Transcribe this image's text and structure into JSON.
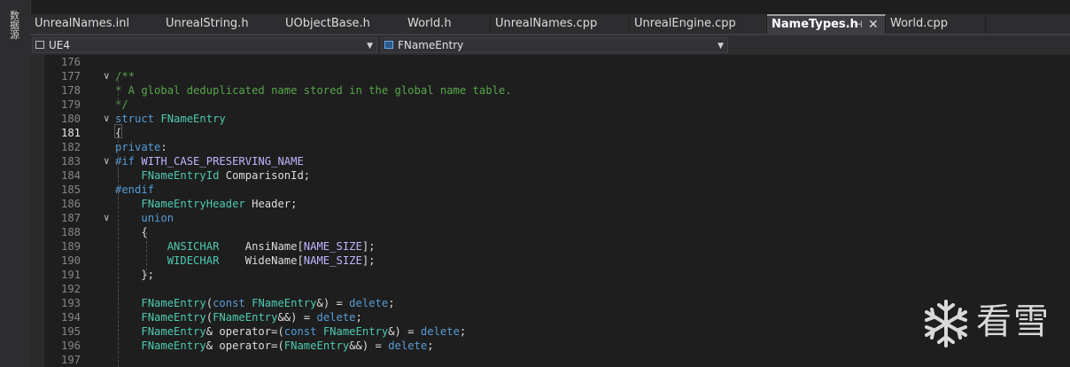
{
  "side_panel": {
    "label": "数据源"
  },
  "tabs": [
    {
      "label": "UnrealNames.inl",
      "active": false
    },
    {
      "label": "UnrealString.h",
      "active": false
    },
    {
      "label": "UObjectBase.h",
      "active": false
    },
    {
      "label": "World.h",
      "active": false
    },
    {
      "label": "UnrealNames.cpp",
      "active": false
    },
    {
      "label": "UnrealEngine.cpp",
      "active": false
    },
    {
      "label": "NameTypes.h",
      "active": true
    },
    {
      "label": "World.cpp",
      "active": false
    }
  ],
  "tab_icons": {
    "pin": "pin-icon",
    "close": "close-icon"
  },
  "navbar": {
    "project": "UE4",
    "scope": "FNameEntry"
  },
  "editor": {
    "current_line": 181,
    "lines": [
      {
        "n": "176",
        "fold": "",
        "html": ""
      },
      {
        "n": "177",
        "fold": "v",
        "html": "<span class=\"c\">/**</span>"
      },
      {
        "n": "178",
        "fold": "",
        "html": "<span class=\"c\">* A global deduplicated name stored in the global name table.</span>"
      },
      {
        "n": "179",
        "fold": "",
        "html": "<span class=\"c\">*/</span>"
      },
      {
        "n": "180",
        "fold": "v",
        "html": "<span class=\"k\">struct</span> <span class=\"t\">FNameEntry</span>"
      },
      {
        "n": "181",
        "fold": "",
        "html": "{"
      },
      {
        "n": "182",
        "fold": "",
        "html": "<span class=\"k\">private</span>:"
      },
      {
        "n": "183",
        "fold": "v",
        "html": "<span class=\"k\">#if</span> <span class=\"m\">WITH_CASE_PRESERVING_NAME</span>"
      },
      {
        "n": "184",
        "fold": "",
        "html": "    <span class=\"t\">FNameEntryId</span> ComparisonId;"
      },
      {
        "n": "185",
        "fold": "",
        "html": "<span class=\"k\">#endif</span>"
      },
      {
        "n": "186",
        "fold": "",
        "html": "    <span class=\"t\">FNameEntryHeader</span> Header;"
      },
      {
        "n": "187",
        "fold": "v",
        "html": "    <span class=\"k\">union</span>"
      },
      {
        "n": "188",
        "fold": "",
        "html": "    {"
      },
      {
        "n": "189",
        "fold": "",
        "html": "        <span class=\"t\">ANSICHAR</span>    AnsiName[<span class=\"m\">NAME_SIZE</span>];"
      },
      {
        "n": "190",
        "fold": "",
        "html": "        <span class=\"t\">WIDECHAR</span>    WideName[<span class=\"m\">NAME_SIZE</span>];"
      },
      {
        "n": "191",
        "fold": "",
        "html": "    };"
      },
      {
        "n": "192",
        "fold": "",
        "html": ""
      },
      {
        "n": "193",
        "fold": "",
        "html": "    <span class=\"t\">FNameEntry</span>(<span class=\"k\">const</span> <span class=\"t\">FNameEntry</span>&amp;) = <span class=\"k\">delete</span>;"
      },
      {
        "n": "194",
        "fold": "",
        "html": "    <span class=\"t\">FNameEntry</span>(<span class=\"t\">FNameEntry</span>&amp;&amp;) = <span class=\"k\">delete</span>;"
      },
      {
        "n": "195",
        "fold": "",
        "html": "    <span class=\"t\">FNameEntry</span>&amp; operator=(<span class=\"k\">const</span> <span class=\"t\">FNameEntry</span>&amp;) = <span class=\"k\">delete</span>;"
      },
      {
        "n": "196",
        "fold": "",
        "html": "    <span class=\"t\">FNameEntry</span>&amp; operator=(<span class=\"t\">FNameEntry</span>&amp;&amp;) = <span class=\"k\">delete</span>;"
      },
      {
        "n": "197",
        "fold": "",
        "html": ""
      }
    ]
  },
  "watermark": {
    "text": "看雪",
    "icon": "snowflake-icon"
  },
  "colors": {
    "background": "#1e1e1e",
    "comment": "#57a64a",
    "keyword": "#569cd6",
    "type": "#4ec9b0",
    "macro": "#beb7ff"
  }
}
